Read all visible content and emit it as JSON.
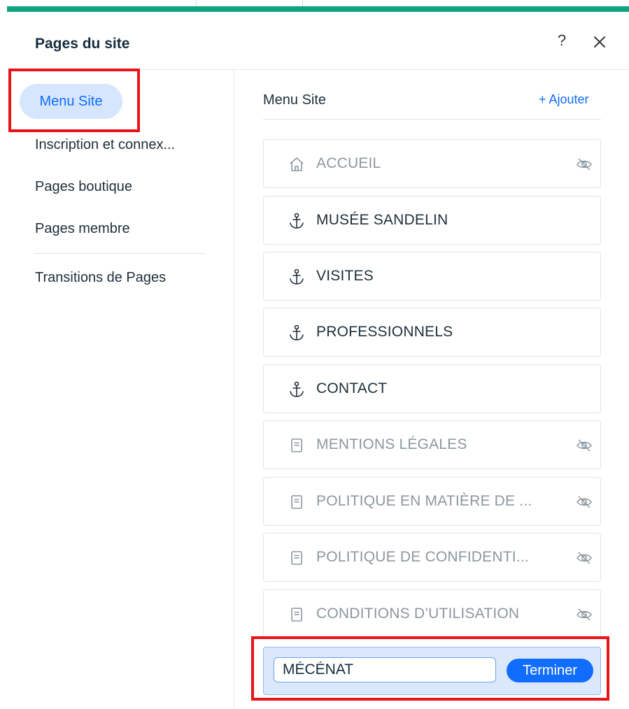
{
  "panel": {
    "title": "Pages du site",
    "help_label": "?"
  },
  "sidebar": {
    "items": [
      {
        "label": "Menu Site"
      },
      {
        "label": "Inscription et connex..."
      },
      {
        "label": "Pages boutique"
      },
      {
        "label": "Pages membre"
      },
      {
        "label": "Transitions de Pages"
      }
    ]
  },
  "menu": {
    "title": "Menu Site",
    "add_label": "+ Ajouter",
    "pages": [
      {
        "label": "ACCUEIL",
        "icon": "home-icon",
        "hidden": true
      },
      {
        "label": "MUSÉE SANDELIN",
        "icon": "anchor-icon",
        "hidden": false
      },
      {
        "label": "VISITES",
        "icon": "anchor-icon",
        "hidden": false
      },
      {
        "label": "PROFESSIONNELS",
        "icon": "anchor-icon",
        "hidden": false
      },
      {
        "label": "CONTACT",
        "icon": "anchor-icon",
        "hidden": false
      },
      {
        "label": "MENTIONS LÉGALES",
        "icon": "page-icon",
        "hidden": true
      },
      {
        "label": "POLITIQUE EN MATIÈRE DE ...",
        "icon": "page-icon",
        "hidden": true
      },
      {
        "label": "POLITIQUE DE CONFIDENTI...",
        "icon": "page-icon",
        "hidden": true
      },
      {
        "label": "CONDITIONS D’UTILISATION",
        "icon": "page-icon",
        "hidden": true
      }
    ],
    "rename": {
      "value": "MÉCÉNAT",
      "done_label": "Terminer"
    }
  },
  "colors": {
    "accent": "#116dff",
    "brand_bar": "#0fa37f",
    "highlight": "#e8141a"
  }
}
